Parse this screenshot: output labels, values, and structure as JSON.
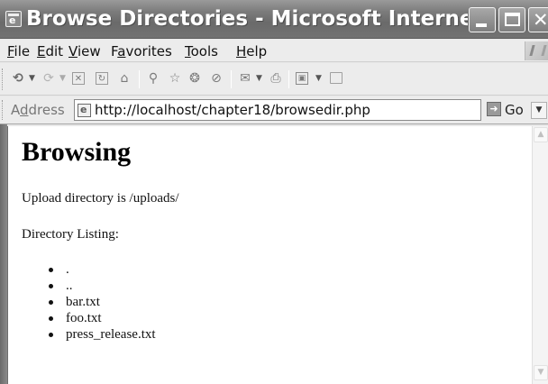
{
  "window": {
    "title": "Browse Directories - Microsoft Internet E..."
  },
  "menubar": {
    "items": [
      {
        "key": "F",
        "rest": "ile"
      },
      {
        "key": "E",
        "rest": "dit"
      },
      {
        "key": "V",
        "rest": "iew"
      },
      {
        "pre": "F",
        "key": "a",
        "rest": "vorites"
      },
      {
        "key": "T",
        "rest": "ools"
      },
      {
        "key": "H",
        "rest": "elp"
      }
    ]
  },
  "toolbar": {
    "icons": {
      "back": "back-icon",
      "forward": "forward-icon",
      "stop": "stop-icon",
      "refresh": "refresh-icon",
      "home": "home-icon",
      "search": "search-icon",
      "favorites": "favorites-icon",
      "media": "media-icon",
      "history": "history-icon",
      "mail": "mail-icon",
      "print": "print-icon",
      "edit": "edit-icon",
      "discuss": "discuss-icon"
    }
  },
  "addressbar": {
    "label_key": "d",
    "label_pre": "A",
    "label_rest": "dress",
    "url": "http://localhost/chapter18/browsedir.php",
    "go_label": "Go"
  },
  "page": {
    "heading": "Browsing",
    "upload_text": "Upload directory is /uploads/",
    "listing_label": "Directory Listing:",
    "entries": [
      ".",
      "..",
      "bar.txt",
      "foo.txt",
      "press_release.txt"
    ]
  },
  "colors": {
    "titlebar": "#7c7c7c",
    "chrome": "#ececec",
    "page_background": "#ffffff"
  }
}
